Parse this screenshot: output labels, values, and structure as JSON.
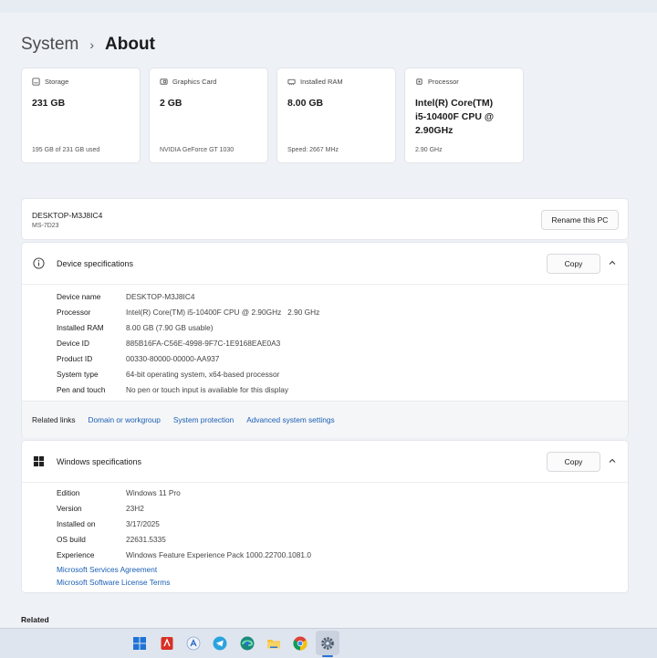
{
  "breadcrumb": {
    "parent": "System",
    "separator": "›",
    "current": "About"
  },
  "cards": [
    {
      "icon": "storage-icon",
      "label": "Storage",
      "value": "231 GB",
      "sub": "195 GB of 231 GB used"
    },
    {
      "icon": "graphics-card-icon",
      "label": "Graphics Card",
      "value": "2 GB",
      "sub": "NVIDIA GeForce GT 1030"
    },
    {
      "icon": "ram-icon",
      "label": "Installed RAM",
      "value": "8.00 GB",
      "sub": "Speed: 2667 MHz"
    },
    {
      "icon": "processor-icon",
      "label": "Processor",
      "value_lines": [
        "Intel(R) Core(TM)",
        "i5-10400F CPU @",
        "2.90GHz"
      ],
      "sub": "2.90 GHz"
    }
  ],
  "pc": {
    "name": "DESKTOP-M3J8IC4",
    "model": "MS-7D23",
    "rename_label": "Rename this PC"
  },
  "device_specs": {
    "title": "Device specifications",
    "copy_label": "Copy",
    "rows": [
      {
        "key": "Device name",
        "value": "DESKTOP-M3J8IC4"
      },
      {
        "key": "Processor",
        "value": "Intel(R) Core(TM) i5-10400F CPU @ 2.90GHz   2.90 GHz"
      },
      {
        "key": "Installed RAM",
        "value": "8.00 GB (7.90 GB usable)"
      },
      {
        "key": "Device ID",
        "value": "885B16FA-C56E-4998-9F7C-1E9168EAE0A3"
      },
      {
        "key": "Product ID",
        "value": "00330-80000-00000-AA937"
      },
      {
        "key": "System type",
        "value": "64-bit operating system, x64-based processor"
      },
      {
        "key": "Pen and touch",
        "value": "No pen or touch input is available for this display"
      }
    ],
    "related_label": "Related links",
    "related_links": [
      "Domain or workgroup",
      "System protection",
      "Advanced system settings"
    ]
  },
  "windows_specs": {
    "title": "Windows specifications",
    "copy_label": "Copy",
    "rows": [
      {
        "key": "Edition",
        "value": "Windows 11 Pro"
      },
      {
        "key": "Version",
        "value": "23H2"
      },
      {
        "key": "Installed on",
        "value": "3/17/2025"
      },
      {
        "key": "OS build",
        "value": "22631.5335"
      },
      {
        "key": "Experience",
        "value": "Windows Feature Experience Pack 1000.22700.1081.0"
      }
    ],
    "links": [
      "Microsoft Services Agreement",
      "Microsoft Software License Terms"
    ]
  },
  "related_title": "Related",
  "taskbar": {
    "icons": [
      "windows-start-icon",
      "pdf-app-icon",
      "app-store-icon",
      "telegram-icon",
      "edge-icon",
      "file-explorer-icon",
      "chrome-icon",
      "settings-icon"
    ],
    "active": "settings-icon"
  }
}
